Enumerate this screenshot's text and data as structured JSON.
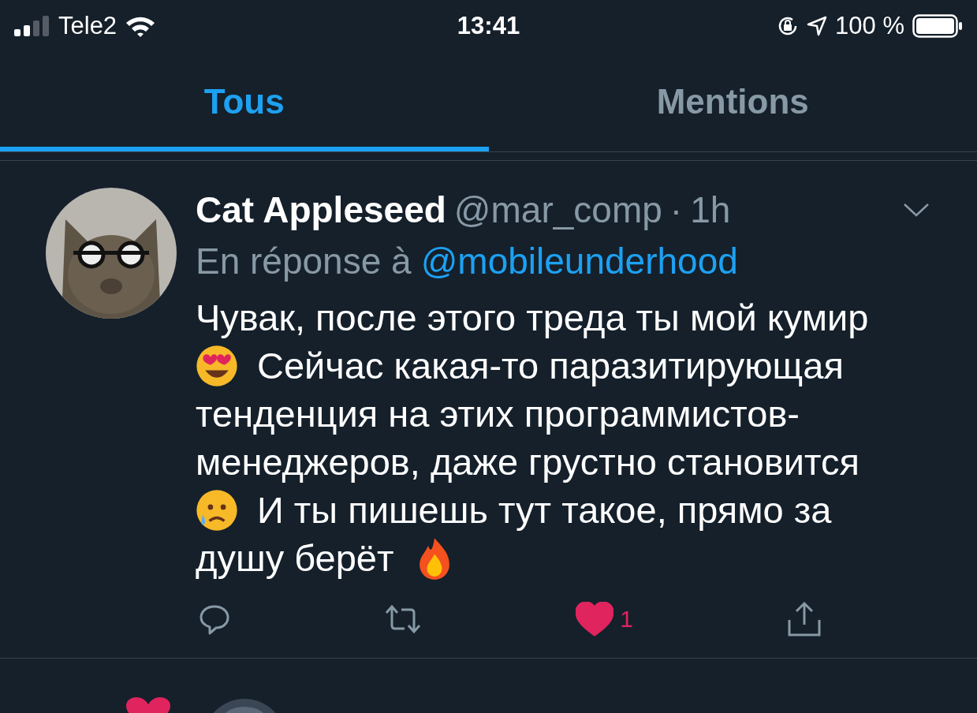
{
  "status_bar": {
    "carrier": "Tele2",
    "time": "13:41",
    "battery": "100 %"
  },
  "tabs": [
    {
      "label": "Tous",
      "selected": true
    },
    {
      "label": "Mentions",
      "selected": false
    }
  ],
  "tweet": {
    "name": "Cat Appleseed",
    "handle": "@mar_comp",
    "separator": "·",
    "time": "1h",
    "reply_prefix": "En réponse à",
    "reply_to": "@mobileunderhood",
    "body_lines": [
      {
        "segments": [
          {
            "kind": "text",
            "text": "Чувак, после этого треда ты мой кумир"
          }
        ]
      },
      {
        "segments": [
          {
            "kind": "hearteyes"
          },
          {
            "kind": "text",
            "text": "Сейчас какая-то паразитирующая"
          }
        ]
      },
      {
        "segments": [
          {
            "kind": "text",
            "text": "тенденция на этих программистов-"
          }
        ]
      },
      {
        "segments": [
          {
            "kind": "text",
            "text": "менеджеров, даже грустно становится"
          }
        ]
      },
      {
        "segments": [
          {
            "kind": "sad"
          },
          {
            "kind": "text",
            "text": "И ты пишешь тут такое, прямо за"
          }
        ]
      },
      {
        "segments": [
          {
            "kind": "text",
            "text": "душу берёт"
          },
          {
            "kind": "fire"
          }
        ]
      }
    ],
    "liked": true,
    "like_count": "1"
  }
}
